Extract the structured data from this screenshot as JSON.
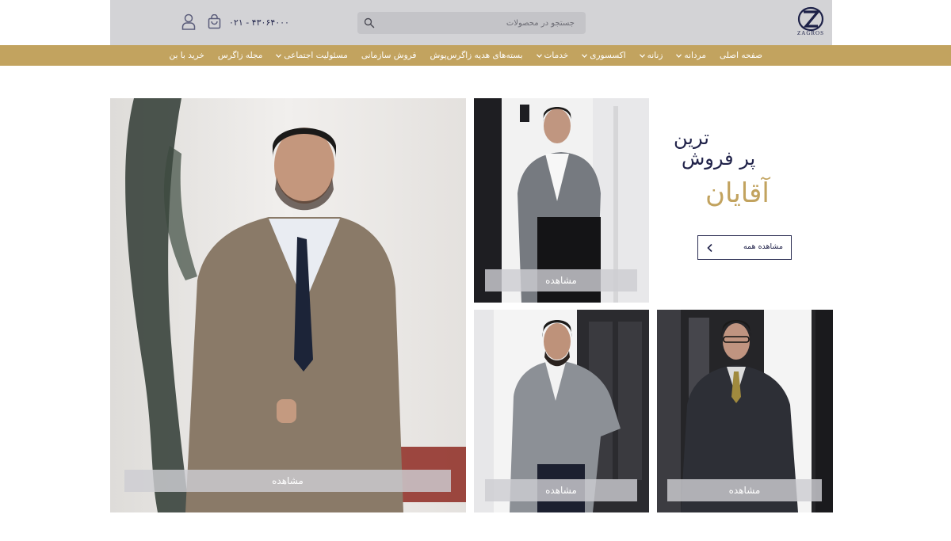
{
  "header": {
    "logo_text": "ZAGROS",
    "search_placeholder": "جستجو در محصولات",
    "phone": "۰۲۱ - ۴۳۰۶۴۰۰۰"
  },
  "nav": {
    "items": [
      {
        "label": "صفحه اصلی",
        "has_dropdown": false
      },
      {
        "label": "مردانه",
        "has_dropdown": true
      },
      {
        "label": "زنانه",
        "has_dropdown": true
      },
      {
        "label": "اکسسوری",
        "has_dropdown": true
      },
      {
        "label": "خدمات",
        "has_dropdown": true
      },
      {
        "label": "بسته‌های هدیه زاگرس‌پوش",
        "has_dropdown": false
      },
      {
        "label": "فروش سازمانی",
        "has_dropdown": false
      },
      {
        "label": "مسئولیت اجتماعی",
        "has_dropdown": true
      },
      {
        "label": "مجله زاگرس",
        "has_dropdown": false
      },
      {
        "label": "خرید با بن",
        "has_dropdown": false
      }
    ]
  },
  "promo": {
    "subtitle": "ترین",
    "main": "پر فروش",
    "title": "آقایان",
    "see_all_label": "مشاهده همه"
  },
  "products": {
    "big": {
      "button_label": "مشاهده"
    },
    "top_right": {
      "button_label": "مشاهده"
    },
    "bottom_left": {
      "button_label": "مشاهده"
    },
    "bottom_right": {
      "button_label": "مشاهده"
    }
  },
  "colors": {
    "brand_gold": "#c2a35f",
    "brand_navy": "#21234a",
    "header_bg": "#d3d3d6"
  }
}
